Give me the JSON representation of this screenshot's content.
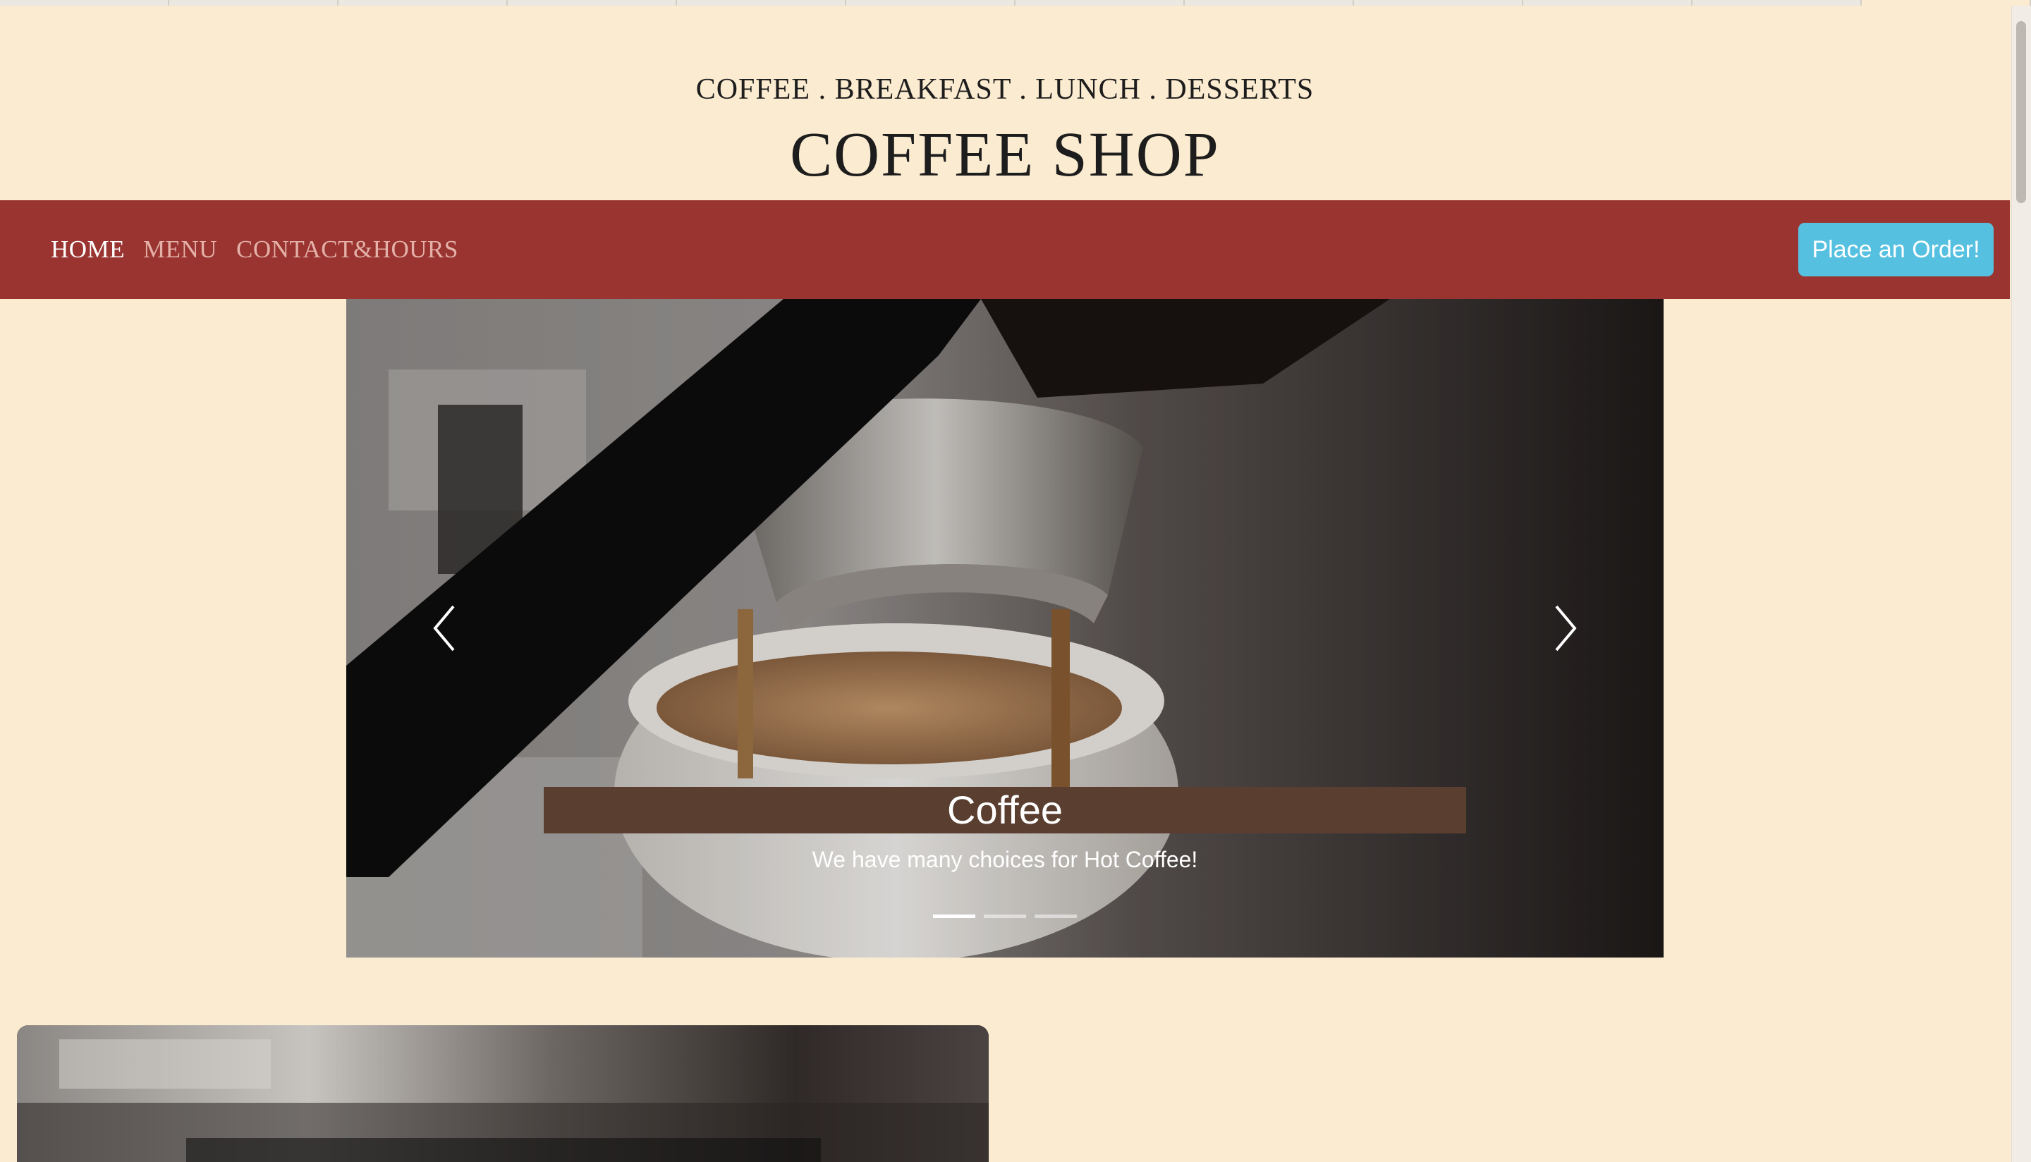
{
  "header": {
    "tagline": "COFFEE . BREAKFAST . LUNCH . DESSERTS",
    "title": "COFFEE SHOP"
  },
  "nav": {
    "items": [
      {
        "label": "HOME",
        "active": true
      },
      {
        "label": "MENU",
        "active": false
      },
      {
        "label": "CONTACT&HOURS",
        "active": false
      }
    ],
    "order_button": "Place an Order!"
  },
  "carousel": {
    "caption_title": "Coffee",
    "caption_text": "We have many choices for Hot Coffee!",
    "slide_count": 3,
    "active_slide": 1,
    "prev_icon": "chevron-left-icon",
    "next_icon": "chevron-right-icon"
  },
  "colors": {
    "page_background": "#fbebd0",
    "navbar": "#993431",
    "order_button": "#56c0e0",
    "caption_band": "#5a3f30"
  }
}
